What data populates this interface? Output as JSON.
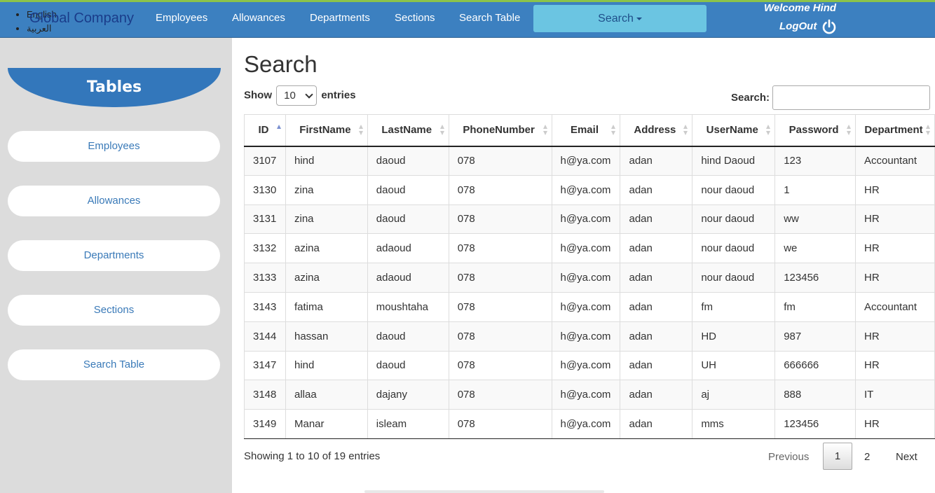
{
  "header": {
    "languages": [
      "English",
      "العربية"
    ],
    "brand": "Global Company",
    "nav": [
      "Employees",
      "Allowances",
      "Departments",
      "Sections",
      "Search Table"
    ],
    "search_dropdown": "Search",
    "welcome": "Welcome Hind",
    "logout": "LogOut",
    "colors": {
      "bar": "#3c80c0",
      "accent": "#8bc34a",
      "search_btn": "#6bc5e2"
    }
  },
  "sidebar": {
    "title": "Tables",
    "items": [
      "Employees",
      "Allowances",
      "Departments",
      "Sections",
      "Search Table"
    ]
  },
  "main": {
    "title": "Search",
    "show_label": "Show",
    "entries_value": "10",
    "entries_label": "entries",
    "search_label": "Search:",
    "search_value": "",
    "table": {
      "columns": [
        "ID",
        "FirstName",
        "LastName",
        "PhoneNumber",
        "Email",
        "Address",
        "UserName",
        "Password",
        "Department"
      ],
      "rows": [
        [
          "3107",
          "hind",
          "daoud",
          "078",
          "h@ya.com",
          "adan",
          "hind Daoud",
          "123",
          "Accountant"
        ],
        [
          "3130",
          "zina",
          "daoud",
          "078",
          "h@ya.com",
          "adan",
          "nour daoud",
          "1",
          "HR"
        ],
        [
          "3131",
          "zina",
          "daoud",
          "078",
          "h@ya.com",
          "adan",
          "nour daoud",
          "ww",
          "HR"
        ],
        [
          "3132",
          "azina",
          "adaoud",
          "078",
          "h@ya.com",
          "adan",
          "nour daoud",
          "we",
          "HR"
        ],
        [
          "3133",
          "azina",
          "adaoud",
          "078",
          "h@ya.com",
          "adan",
          "nour daoud",
          "123456",
          "HR"
        ],
        [
          "3143",
          "fatima",
          "moushtaha",
          "078",
          "h@ya.com",
          "adan",
          "fm",
          "fm",
          "Accountant"
        ],
        [
          "3144",
          "hassan",
          "daoud",
          "078",
          "h@ya.com",
          "adan",
          "HD",
          "987",
          "HR"
        ],
        [
          "3147",
          "hind",
          "daoud",
          "078",
          "h@ya.com",
          "adan",
          "UH",
          "666666",
          "HR"
        ],
        [
          "3148",
          "allaa",
          "dajany",
          "078",
          "h@ya.com",
          "adan",
          "aj",
          "888",
          "IT"
        ],
        [
          "3149",
          "Manar",
          "isleam",
          "078",
          "h@ya.com",
          "adan",
          "mms",
          "123456",
          "HR"
        ]
      ]
    },
    "info": "Showing 1 to 10 of 19 entries",
    "pager": {
      "previous": "Previous",
      "pages": [
        "1",
        "2"
      ],
      "next": "Next"
    }
  }
}
